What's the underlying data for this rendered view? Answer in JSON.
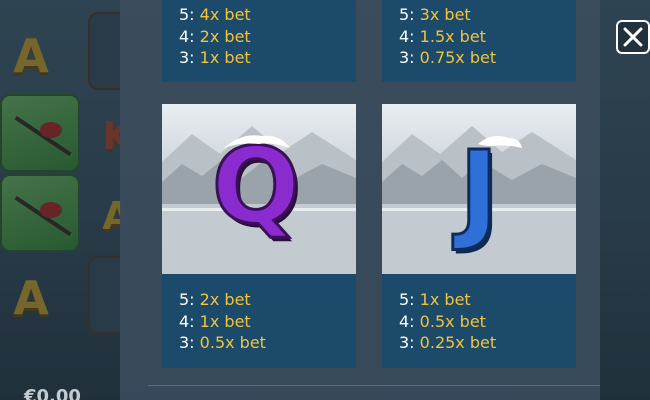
{
  "background": {
    "reel_letters": [
      "A",
      "A",
      "A",
      "K"
    ],
    "balance_text": "€0.00"
  },
  "paytable": {
    "top_left": {
      "lines": [
        {
          "count": "5:",
          "value": "4x bet"
        },
        {
          "count": "4:",
          "value": "2x bet"
        },
        {
          "count": "3:",
          "value": "1x bet"
        }
      ]
    },
    "top_right": {
      "lines": [
        {
          "count": "5:",
          "value": "3x bet"
        },
        {
          "count": "4:",
          "value": "1.5x bet"
        },
        {
          "count": "3:",
          "value": "0.75x bet"
        }
      ]
    },
    "q_card": {
      "symbol": "Q",
      "symbol_color": "#8a2bd0",
      "lines": [
        {
          "count": "5:",
          "value": "2x bet"
        },
        {
          "count": "4:",
          "value": "1x bet"
        },
        {
          "count": "3:",
          "value": "0.5x bet"
        }
      ]
    },
    "j_card": {
      "symbol": "J",
      "symbol_color": "#2f6fd8",
      "lines": [
        {
          "count": "5:",
          "value": "1x bet"
        },
        {
          "count": "4:",
          "value": "0.5x bet"
        },
        {
          "count": "3:",
          "value": "0.25x bet"
        }
      ]
    }
  },
  "close_button": {
    "icon": "close-icon"
  },
  "colors": {
    "pay_value": "#f2c33a",
    "card_bg": "#1c4a6a",
    "panel_bg": "#3b4d5c"
  }
}
